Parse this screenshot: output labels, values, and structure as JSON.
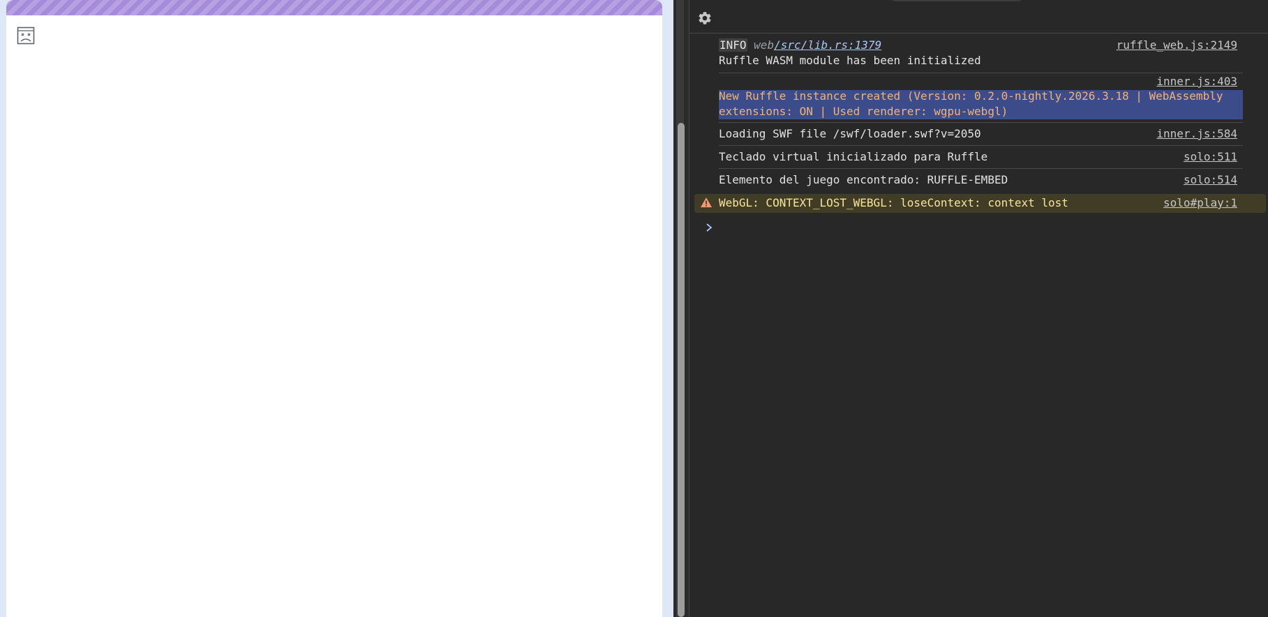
{
  "page": {
    "broken_image_icon": "broken-image-icon",
    "stripe_colors": [
      "#b8a1e3",
      "#a58bd8"
    ]
  },
  "devtools": {
    "settings_icon": "gear-icon",
    "messages": [
      {
        "level": "info",
        "tag": "INFO",
        "module": "web",
        "path": "/src/lib.rs:1379",
        "text": " Ruffle WASM module has been initialized",
        "source": "ruffle_web.js:2149"
      },
      {
        "level": "highlighted",
        "text": "New Ruffle instance created (Version: 0.2.0-nightly.2026.3.18 | WebAssembly extensions: ON | Used renderer: wgpu-webgl)",
        "source": "inner.js:403"
      },
      {
        "level": "log",
        "text": "Loading SWF file /swf/loader.swf?v=2050",
        "source": "inner.js:584"
      },
      {
        "level": "log",
        "text": "Teclado virtual inicializado para Ruffle",
        "source": "solo:511"
      },
      {
        "level": "log",
        "text": "Elemento del juego encontrado: RUFFLE-EMBED",
        "source": "solo:514"
      },
      {
        "level": "warning",
        "text": "WebGL: CONTEXT_LOST_WEBGL: loseContext: context lost",
        "source": "solo#play:1",
        "icon": "warning-icon"
      }
    ],
    "prompt_icon": "chevron-right-icon",
    "colors": {
      "background": "#282828",
      "highlight": "#3c4b8a",
      "highlight_text": "#f1b377",
      "warning_bg": "#413c26",
      "warning_text": "#f7e59a",
      "prompt": "#a8c7fa"
    }
  }
}
